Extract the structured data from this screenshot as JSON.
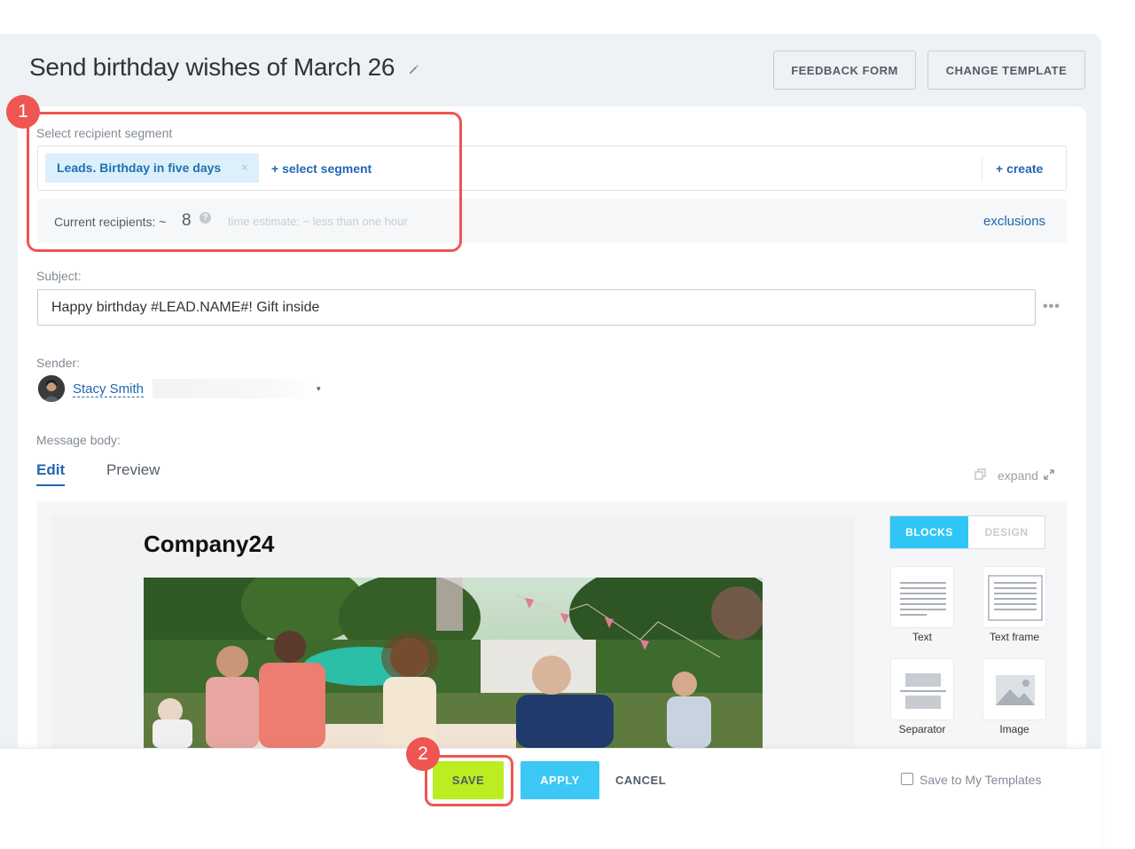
{
  "header": {
    "title": "Send birthday wishes of March 26",
    "feedback_form": "FEEDBACK FORM",
    "change_template": "CHANGE TEMPLATE"
  },
  "segment": {
    "label": "Select recipient segment",
    "chip": "Leads. Birthday in five days",
    "chip_remove": "×",
    "select_segment": "+ select segment",
    "create": "+ create",
    "current_recipients_label": "Current recipients: ~",
    "current_recipients_count": "8",
    "help": "?",
    "time_estimate": "time estimate: ~ less than one hour",
    "exclusions": "exclusions"
  },
  "subject": {
    "label": "Subject:",
    "value": "Happy birthday #LEAD.NAME#! Gift inside",
    "more": "•••"
  },
  "sender": {
    "label": "Sender:",
    "name": "Stacy Smith",
    "caret": "▾"
  },
  "message": {
    "label": "Message body:",
    "tab_edit": "Edit",
    "tab_preview": "Preview",
    "expand": "expand"
  },
  "email_preview": {
    "company": "Company24"
  },
  "palette": {
    "blocks_tab": "BLOCKS",
    "design_tab": "DESIGN",
    "blocks": [
      {
        "label": "Text",
        "icon": "text-block-icon"
      },
      {
        "label": "Text frame",
        "icon": "text-frame-icon"
      },
      {
        "label": "Separator",
        "icon": "separator-icon"
      },
      {
        "label": "Image",
        "icon": "image-icon"
      }
    ]
  },
  "footer": {
    "save": "SAVE",
    "apply": "APPLY",
    "cancel": "CANCEL",
    "save_to_templates": "Save to My Templates"
  },
  "annotations": {
    "badge1": "1",
    "badge2": "2"
  },
  "colors": {
    "accent_blue": "#2067b0",
    "save_green": "#bbed21",
    "apply_cyan": "#3bc8f5",
    "highlight_red": "#ef5552"
  }
}
